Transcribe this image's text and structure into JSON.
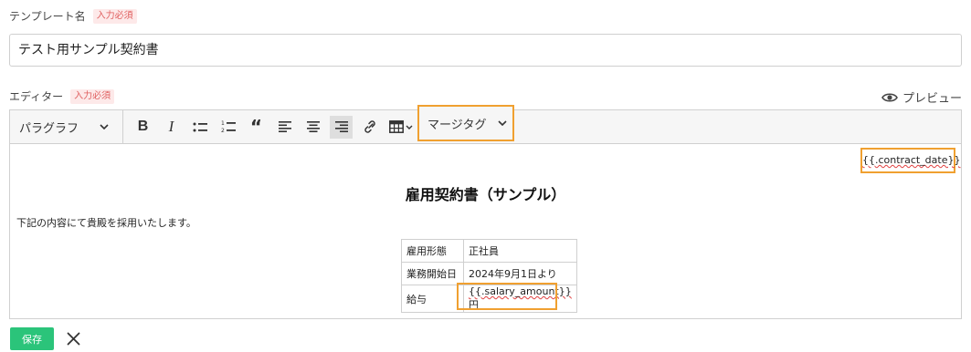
{
  "template_name": {
    "label": "テンプレート名",
    "required_badge": "入力必須",
    "value": "テスト用サンプル契約書"
  },
  "editor": {
    "label": "エディター",
    "required_badge": "入力必須",
    "preview_label": "プレビュー",
    "toolbar": {
      "paragraph_select": "パラグラフ",
      "buttons": [
        {
          "name": "bold-button",
          "icon": "B"
        },
        {
          "name": "italic-button",
          "icon": "I"
        },
        {
          "name": "bullet-list-button",
          "icon": "bullet-list-icon"
        },
        {
          "name": "numbered-list-button",
          "icon": "numbered-list-icon"
        },
        {
          "name": "quote-button",
          "icon": "“"
        },
        {
          "name": "align-left-button",
          "icon": "align-left-icon"
        },
        {
          "name": "align-center-button",
          "icon": "align-center-icon"
        },
        {
          "name": "align-right-button",
          "icon": "align-right-icon",
          "active": true
        },
        {
          "name": "link-button",
          "icon": "link-icon"
        },
        {
          "name": "table-button",
          "icon": "table-icon"
        }
      ],
      "merge_tag_select": "マージタグ"
    },
    "content": {
      "date_tag": "{{.contract_date}}",
      "title": "雇用契約書（サンプル）",
      "intro": "下記の内容にて貴殿を採用いたします。",
      "table": [
        {
          "key": "雇用形態",
          "value": "正社員"
        },
        {
          "key": "業務開始日",
          "value": "2024年9月1日より"
        },
        {
          "key": "給与",
          "value_tag": "{{.salary_amount}}",
          "value_suffix": "円"
        }
      ]
    }
  },
  "actions": {
    "save_label": "保存",
    "close_icon": "close-icon"
  },
  "colors": {
    "accent_highlight": "#f0a030",
    "save_button": "#2bc47a",
    "required_badge_text": "#e06060",
    "required_badge_bg": "#fde9e9"
  }
}
